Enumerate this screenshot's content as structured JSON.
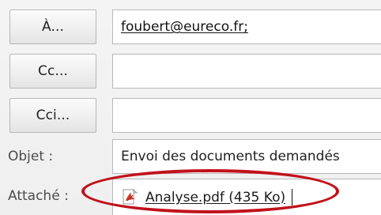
{
  "recipients": {
    "to_label": "À...",
    "to_value": "foubert@eureco.fr;",
    "cc_label": "Cc...",
    "cc_value": "",
    "bcc_label": "Cci...",
    "bcc_value": ""
  },
  "subject": {
    "label": "Objet :",
    "value": "Envoi des documents demandés"
  },
  "attachment": {
    "label": "Attaché :",
    "file_name": "Analyse.pdf (435 Ko)",
    "icon": "pdf-icon"
  },
  "colors": {
    "highlight": "#c0121b",
    "pdf_icon": "#d53a2b"
  }
}
